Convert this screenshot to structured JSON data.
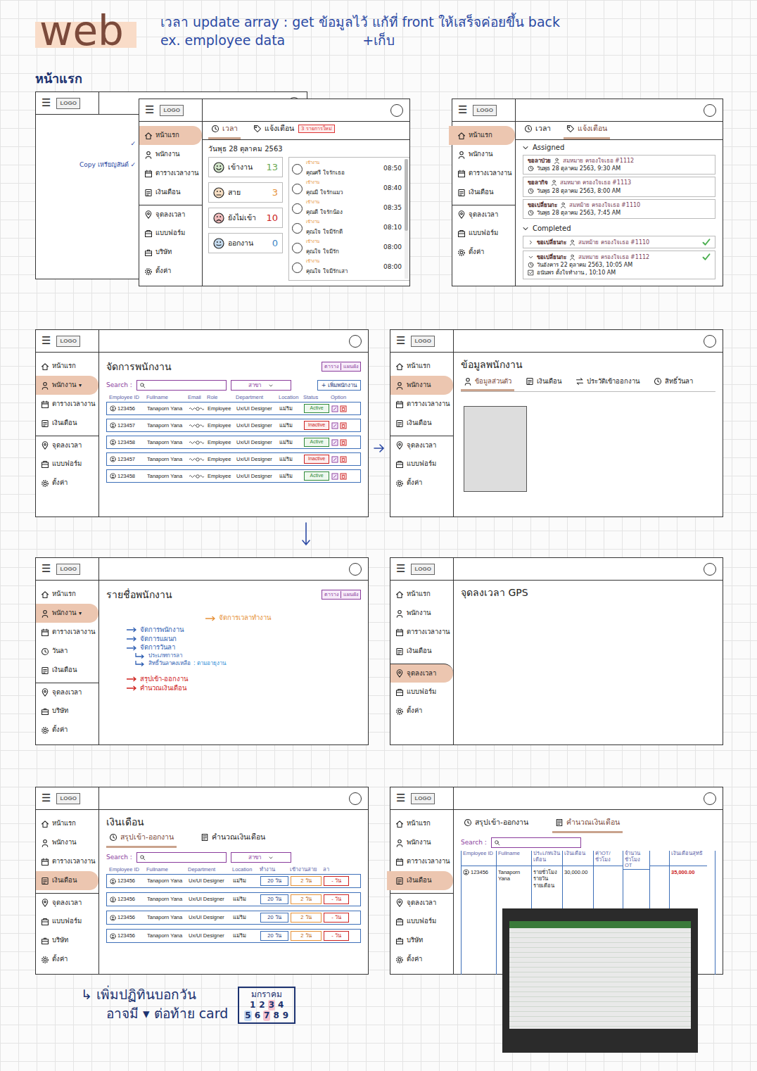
{
  "header": {
    "title": "web",
    "note": "เวลา update array : get ข้อมูลไว้ แก้ที่ front ให้เสร็จค่อยขึ้น back",
    "example": "ex. employee data",
    "addition": "+เก็บ"
  },
  "section_title": "หน้าแรก",
  "back_frame": {
    "menu": "☰",
    "logo": "LOGO",
    "marks": [
      "✓",
      "Copy เหรียญสันต์ ✓"
    ]
  },
  "home": {
    "menu": "☰",
    "logo": "LOGO",
    "sidebar": [
      {
        "kind": "home",
        "label": "หน้าแรก",
        "selected": true
      },
      {
        "kind": "people",
        "label": "พนักงาน",
        "selected": false
      },
      {
        "kind": "calendar",
        "label": "ตารางเวลางาน",
        "selected": false
      },
      {
        "kind": "money",
        "label": "เงินเดือน",
        "selected": false
      },
      {
        "kind": "pin",
        "label": "จุดลงเวลา",
        "selected": false
      },
      {
        "kind": "form",
        "label": "แบบฟอร์ม",
        "selected": false
      },
      {
        "kind": "company",
        "label": "บริษัท",
        "selected": false
      },
      {
        "kind": "settings",
        "label": "ตั้งค่า",
        "selected": false
      }
    ],
    "tabs": [
      {
        "kind": "clock",
        "label": "เวลา",
        "selected": true
      },
      {
        "kind": "tag",
        "label": "แจ้งเตือน",
        "selected": false,
        "badge": "3 รายการใหม่"
      }
    ],
    "date": "วันพุธ 28 ตุลาคม 2563",
    "stats": [
      {
        "kind": "happy",
        "label": "เข้างาน",
        "value": "13",
        "color": "#6aa84f"
      },
      {
        "kind": "meh",
        "label": "สาย",
        "value": "3",
        "color": "#e69138"
      },
      {
        "kind": "sad",
        "label": "ยังไม่เข้า",
        "value": "10",
        "color": "#cc2222"
      },
      {
        "kind": "calm",
        "label": "ออกงาน",
        "value": "0",
        "color": "#3d85c6"
      }
    ],
    "checkins": [
      {
        "tag": "เข้างาน",
        "name": "คุณศรี ใจรักเธอ",
        "time": "08:50"
      },
      {
        "tag": "เข้างาน",
        "name": "คุณมี ใจรักแมว",
        "time": "08:40"
      },
      {
        "tag": "เข้างาน",
        "name": "คุณดี ใจรักน้อง",
        "time": "08:35"
      },
      {
        "tag": "เข้างาน",
        "name": "คุณใจ ใจมีรักดี",
        "time": "08:10"
      },
      {
        "tag": "เข้างาน",
        "name": "คุณใจ ใจมีรัก",
        "time": "08:00"
      },
      {
        "tag": "เข้างาน",
        "name": "คุณใจ ใจมีรักเสา",
        "time": "08:00"
      }
    ]
  },
  "notifications": {
    "menu": "☰",
    "logo": "LOGO",
    "sidebar": [
      {
        "kind": "home",
        "label": "หน้าแรก",
        "selected": true
      },
      {
        "kind": "people",
        "label": "พนักงาน",
        "selected": false
      },
      {
        "kind": "calendar",
        "label": "ตารางเวลางาน",
        "selected": false
      },
      {
        "kind": "money",
        "label": "เงินเดือน",
        "selected": false
      },
      {
        "kind": "pin",
        "label": "จุดลงเวลา",
        "selected": false
      },
      {
        "kind": "form",
        "label": "แบบฟอร์ม",
        "selected": false
      },
      {
        "kind": "settings",
        "label": "ตั้งค่า",
        "selected": false
      }
    ],
    "tabs": [
      {
        "kind": "clock",
        "label": "เวลา",
        "selected": false
      },
      {
        "kind": "tag",
        "label": "แจ้งเตือน",
        "selected": true
      }
    ],
    "groups": [
      {
        "title": "Assigned",
        "expanded": true,
        "items": [
          {
            "title": "ขอลาป่วย",
            "person": "สมหมาย ครองใจเธอ #1112",
            "time": "วันพุธ 28 ตุลาคม 2563, 9:30 AM",
            "done": false
          },
          {
            "title": "ขอลากิจ",
            "person": "สมหมาด ครองใจเธอ #1113",
            "time": "วันพุธ 28 ตุลาคม 2563, 8:00 AM",
            "done": false
          },
          {
            "title": "ขอเปลี่ยนกะ",
            "person": "สมหม้าย ครองใจเธอ #1110",
            "time": "วันพุธ 28 ตุลาคม 2563, 7:45 AM",
            "done": false
          }
        ]
      },
      {
        "title": "Completed",
        "expanded": true,
        "items": [
          {
            "title": "ขอเปลี่ยนกะ",
            "person": "สมหม้าย ครองใจเธอ #1110",
            "expanded": false,
            "done": true
          },
          {
            "title": "ขอเปลี่ยนกะ",
            "person": "สมหมาย ครองใจเธอ #1112",
            "time": "วันอังคาร 22 ตุลาคม 2563, 10:05 AM",
            "note": "อนันพร ตั้งใจทำงาน , 10:10 AM",
            "expanded": true,
            "done": true
          }
        ]
      }
    ]
  },
  "employees": {
    "menu": "☰",
    "logo": "LOGO",
    "sidebar": [
      {
        "kind": "home",
        "label": "หน้าแรก",
        "selected": false
      },
      {
        "kind": "people",
        "label": "พนักงาน",
        "caret": "▾",
        "selected": true
      },
      {
        "kind": "calendar",
        "label": "ตารางเวลางาน",
        "selected": false
      },
      {
        "kind": "money",
        "label": "เงินเดือน",
        "selected": false
      },
      {
        "kind": "pin",
        "label": "จุดลงเวลา",
        "selected": false
      },
      {
        "kind": "form",
        "label": "แบบฟอร์ม",
        "selected": false
      },
      {
        "kind": "settings",
        "label": "ตั้งค่า",
        "selected": false
      }
    ],
    "title": "จัดการพนักงาน",
    "view_toggle": [
      "ตาราง",
      "แผนผัง"
    ],
    "search_label": "Search :",
    "branch": "สาขา",
    "add_button": "+ เพิ่มพนักงาน",
    "columns": [
      "Employee ID",
      "Fullname",
      "Email",
      "Role",
      "Department",
      "Location",
      "Status",
      "Option"
    ],
    "rows": [
      {
        "id": "123456",
        "name": "Tanaporn Yana",
        "role": "Employee",
        "department": "Ux/UI Designer",
        "location": "แม่ริม",
        "status": "Active",
        "active": true
      },
      {
        "id": "123457",
        "name": "Tanaporn Yana",
        "role": "Employee",
        "department": "Ux/UI Designer",
        "location": "แม่ริม",
        "status": "Inactive",
        "active": false
      },
      {
        "id": "123458",
        "name": "Tanaporn Yana",
        "role": "Employee",
        "department": "Ux/UI Designer",
        "location": "แม่ริม",
        "status": "Active",
        "active": true
      },
      {
        "id": "123457",
        "name": "Tanaporn Yana",
        "role": "Employee",
        "department": "Ux/UI Designer",
        "location": "แม่ริม",
        "status": "Inactive",
        "active": false
      },
      {
        "id": "123458",
        "name": "Tanaporn Yana",
        "role": "Employee",
        "department": "Ux/UI Designer",
        "location": "แม่ริม",
        "status": "Active",
        "active": true
      }
    ]
  },
  "employee_info": {
    "menu": "☰",
    "logo": "LOGO",
    "sidebar": [
      {
        "kind": "home",
        "label": "หน้าแรก",
        "selected": false
      },
      {
        "kind": "people",
        "label": "พนักงาน",
        "selected": true
      },
      {
        "kind": "calendar",
        "label": "ตารางเวลางาน",
        "selected": false
      },
      {
        "kind": "money",
        "label": "เงินเดือน",
        "selected": false
      },
      {
        "kind": "pin",
        "label": "จุดลงเวลา",
        "selected": false
      },
      {
        "kind": "form",
        "label": "แบบฟอร์ม",
        "selected": false
      },
      {
        "kind": "settings",
        "label": "ตั้งค่า",
        "selected": false
      }
    ],
    "title": "ข้อมูลพนักงาน",
    "tabs": [
      {
        "kind": "people",
        "label": "ข้อมูลส่วนตัว",
        "selected": true
      },
      {
        "kind": "money",
        "label": "เงินเดือน",
        "selected": false
      },
      {
        "kind": "swap",
        "label": "ประวัติเข้าออกงาน",
        "selected": false
      },
      {
        "kind": "clock",
        "label": "สิทธิ์วันลา",
        "selected": false
      }
    ]
  },
  "employee_list": {
    "menu": "☰",
    "logo": "LOGO",
    "sidebar": [
      {
        "kind": "home",
        "label": "หน้าแรก",
        "selected": false
      },
      {
        "kind": "people",
        "label": "พนักงาน",
        "caret": "▾",
        "selected": true
      },
      {
        "kind": "calendar",
        "label": "ตารางเวลางาน",
        "selected": false
      },
      {
        "kind": "leave",
        "label": "วันลา",
        "selected": false
      },
      {
        "kind": "money",
        "label": "เงินเดือน",
        "selected": false
      },
      {
        "kind": "pin",
        "label": "จุดลงเวลา",
        "selected": false
      },
      {
        "kind": "company",
        "label": "บริษัท",
        "selected": false
      },
      {
        "kind": "settings",
        "label": "ตั้งค่า",
        "selected": false
      }
    ],
    "title": "รายชื่อพนักงาน",
    "view_toggle": [
      "ตาราง",
      "แผนผัง"
    ],
    "annotations": [
      {
        "text": "จัดการเวลาทำงาน",
        "color": "#e69138",
        "kind": "top"
      },
      {
        "text": "จัดการพนักงาน",
        "color": "#2f5fb3",
        "kind": "main"
      },
      {
        "text": "จัดการแผนก",
        "color": "#2f5fb3",
        "kind": "main"
      },
      {
        "text": "จัดการวันลา",
        "color": "#2f5fb3",
        "kind": "main"
      },
      {
        "text": "ประเภทการลา",
        "color": "#2f5fb3",
        "kind": "sub"
      },
      {
        "text": "สิทธิ์วันลาคงเหลือ",
        "suffix": ": ตามอายุงาน",
        "color": "#2f5fb3",
        "kind": "sub"
      },
      {
        "text": "สรุปเข้า-ออกงาน",
        "color": "#d0211c",
        "kind": "end"
      },
      {
        "text": "คำนวณเงินเดือน",
        "color": "#d0211c",
        "kind": "main"
      }
    ]
  },
  "gps": {
    "menu": "☰",
    "logo": "LOGO",
    "sidebar": [
      {
        "kind": "home",
        "label": "หน้าแรก",
        "selected": false
      },
      {
        "kind": "people",
        "label": "พนักงาน",
        "selected": false
      },
      {
        "kind": "calendar",
        "label": "ตารางเวลางาน",
        "selected": false
      },
      {
        "kind": "money",
        "label": "เงินเดือน",
        "selected": false
      },
      {
        "kind": "pin",
        "label": "จุดลงเวลา",
        "selected": true
      },
      {
        "kind": "form",
        "label": "แบบฟอร์ม",
        "selected": false
      },
      {
        "kind": "settings",
        "label": "ตั้งค่า",
        "selected": false
      }
    ],
    "title": "จุดลงเวลา GPS"
  },
  "salary": {
    "menu": "☰",
    "logo": "LOGO",
    "sidebar": [
      {
        "kind": "home",
        "label": "หน้าแรก",
        "selected": false
      },
      {
        "kind": "people",
        "label": "พนักงาน",
        "selected": false
      },
      {
        "kind": "calendar",
        "label": "ตารางเวลางาน",
        "selected": false
      },
      {
        "kind": "money",
        "label": "เงินเดือน",
        "selected": true
      },
      {
        "kind": "pin",
        "label": "จุดลงเวลา",
        "selected": false
      },
      {
        "kind": "form",
        "label": "แบบฟอร์ม",
        "selected": false
      },
      {
        "kind": "company",
        "label": "บริษัท",
        "selected": false
      },
      {
        "kind": "settings",
        "label": "ตั้งค่า",
        "selected": false
      }
    ],
    "title": "เงินเดือน",
    "tabs": [
      {
        "kind": "clock",
        "label": "สรุปเข้า-ออกงาน",
        "selected": true
      },
      {
        "kind": "sheet",
        "label": "คำนวณเงินเดือน",
        "selected": false
      }
    ],
    "search_label": "Search :",
    "branch": "สาขา",
    "columns": [
      "Employee ID",
      "Fullname",
      "Department",
      "Location",
      "ทำงาน",
      "เข้างานสาย",
      "ลา"
    ],
    "rows": [
      {
        "cells": [
          "123456",
          "Tanaporn Yana",
          "Ux/UI Designer",
          "แม่ริม",
          "20 วัน",
          "2 วัน",
          "- วัน"
        ]
      },
      {
        "cells": [
          "123456",
          "Tanaporn Yana",
          "Ux/UI Designer",
          "แม่ริม",
          "20 วัน",
          "2 วัน",
          "- วัน"
        ]
      },
      {
        "cells": [
          "123456",
          "Tanaporn Yana",
          "Ux/UI Designer",
          "แม่ริม",
          "20 วัน",
          "2 วัน",
          "- วัน"
        ]
      },
      {
        "cells": [
          "123456",
          "Tanaporn Yana",
          "Ux/UI Designer",
          "แม่ริม",
          "20 วัน",
          "2 วัน",
          "- วัน"
        ]
      }
    ]
  },
  "salary_calc": {
    "menu": "☰",
    "logo": "LOGO",
    "sidebar": [
      {
        "kind": "home",
        "label": "หน้าแรก",
        "selected": false
      },
      {
        "kind": "people",
        "label": "พนักงาน",
        "selected": false
      },
      {
        "kind": "calendar",
        "label": "ตารางเวลางาน",
        "selected": false
      },
      {
        "kind": "money",
        "label": "เงินเดือน",
        "selected": true
      },
      {
        "kind": "pin",
        "label": "จุดลงเวลา",
        "selected": false
      },
      {
        "kind": "form",
        "label": "แบบฟอร์ม",
        "selected": false
      },
      {
        "kind": "company",
        "label": "บริษัท",
        "selected": false
      },
      {
        "kind": "settings",
        "label": "ตั้งค่า",
        "selected": false
      }
    ],
    "tabs": [
      {
        "kind": "clock",
        "label": "สรุปเข้า-ออกงาน",
        "selected": false
      },
      {
        "kind": "sheet",
        "label": "คำนวณเงินเดือน",
        "selected": true
      }
    ],
    "search_label": "Search :",
    "columns": [
      "Employee ID",
      "Fullname",
      "ประเภทเงินเดือน",
      "เงินเดือน",
      "ค่าOT/ชั่วโมง",
      "จำนวนชั่วโมง OT",
      "",
      "เงินเดือนสุทธิ"
    ],
    "rows": [
      {
        "cells": [
          [
            "123456"
          ],
          [
            "Tanaporn Yana"
          ],
          [
            "รายชั่วโมง",
            "รายวัน",
            "รายเดือน"
          ],
          [
            "30,000.00"
          ],
          [],
          [],
          [],
          [
            "35,000.00"
          ]
        ]
      }
    ]
  },
  "footer": {
    "line1": "↳ เพิ่มปฏิทินบอกวัน",
    "line2": "อาจมี ▾ ต่อท้าย card",
    "calendar": {
      "month": "มกราคม",
      "weeks": [
        [
          {
            "day": "1"
          },
          {
            "day": "2"
          },
          {
            "day": "3",
            "color": "#f6c2cf"
          },
          {
            "day": "4"
          }
        ],
        [
          {
            "day": "5",
            "color": "#c4dcf6"
          },
          {
            "day": "6"
          },
          {
            "day": "7",
            "color": "#f6c2cf"
          },
          {
            "day": "8"
          },
          {
            "day": "9"
          }
        ]
      ]
    }
  }
}
